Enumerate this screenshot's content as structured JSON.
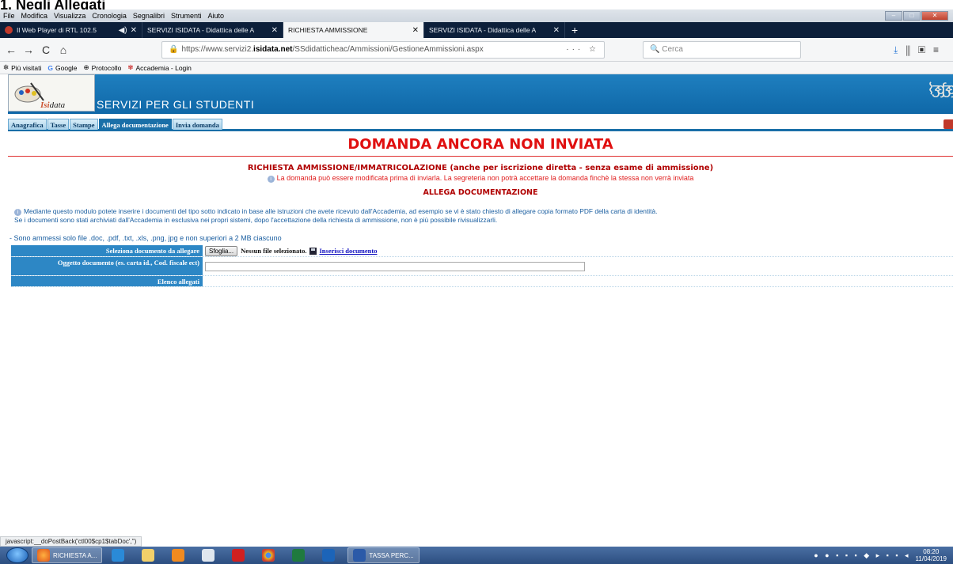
{
  "top_heading": "1.  Negli Allegati",
  "menubar": {
    "items": [
      "File",
      "Modifica",
      "Visualizza",
      "Cronologia",
      "Segnalibri",
      "Strumenti",
      "Aiuto"
    ]
  },
  "browser_tabs": [
    {
      "title": "Il Web Player di RTL 102.5",
      "audio": "◀)",
      "close": "✕"
    },
    {
      "title": "SERVIZI ISIDATA - Didattica delle A",
      "close": "✕"
    },
    {
      "title": "RICHIESTA AMMISSIONE",
      "close": "✕"
    },
    {
      "title": "SERVIZI ISIDATA - Didattica delle A",
      "close": "✕"
    }
  ],
  "new_tab": "+",
  "nav": {
    "back": "←",
    "forward": "→",
    "reload": "C",
    "home": "⌂",
    "url_prefix": "https://www.servizi2.",
    "url_domain": "isidata.net",
    "url_path": "/SSdidatticheac/Ammissioni/GestioneAmmissioni.aspx",
    "url_actions": "··· ☆",
    "search_placeholder": "Cerca"
  },
  "bookmarks": [
    "Più visitati",
    "Google",
    "Protocollo",
    "Accademia - Login"
  ],
  "site": {
    "logo_text_a": "Isi",
    "logo_text_b": "data",
    "title": "SERVIZI PER GLI STUDENTI"
  },
  "page_tabs": [
    "Anagrafica",
    "Tasse",
    "Stampe",
    "Allega documentazione",
    "Invia domanda"
  ],
  "status": "DOMANDA ANCORA NON INVIATA",
  "subtitle": "RICHIESTA AMMISSIONE/IMMATRICOLAZIONE (anche per iscrizione diretta - senza esame di ammissione)",
  "note": "La domanda può essere modificata prima di inviarla. La segreteria non potrà accettare la domanda finchè la stessa non verrà inviata",
  "section_title": "ALLEGA DOCUMENTAZIONE",
  "info_line1": "Mediante questo modulo potete inserire i documenti del tipo sotto indicato in base alle istruzioni che avete ricevuto dall'Accademia, ad esempio se vi è stato chiesto di allegare copia formato PDF della carta di identità.",
  "info_line2": "Se i documenti sono stati archiviati dall'Accademia in esclusiva nei propri sistemi, dopo l'accettazione della richiesta di ammissione, non è più possibile rivisualizzarli.",
  "allowed_files": "- Sono ammessi solo file .doc, .pdf, .txt, .xls, .png, jpg e non superiori a 2 MB ciascuno",
  "form": {
    "select_label": "Seleziona documento da allegare",
    "browse_button": "Sfoglia...",
    "no_file": "Nessun file selezionato.",
    "insert_link": "Inserisci documento",
    "subject_label": "Oggetto documento (es. carta id., Cod. fiscale ect)",
    "subject_value": "",
    "list_label": "Elenco allegati"
  },
  "status_url": "javascript:__doPostBack('ctl00$cp1$tabDoc','')",
  "taskbar": {
    "items": [
      "RICHIESTA A...",
      "TASSA PERC..."
    ],
    "time": "08:20",
    "date": "11/04/2019"
  }
}
